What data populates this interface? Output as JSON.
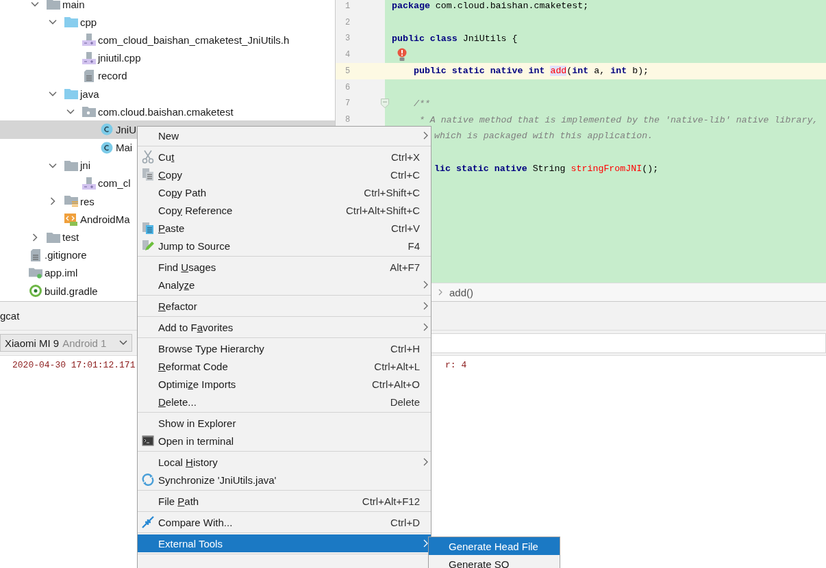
{
  "project_tree": {
    "nested_items": [
      {
        "label": "main",
        "kind": "folder",
        "expanded": true,
        "selected": false,
        "children": [
          {
            "label": "cpp",
            "kind": "source-folder",
            "expanded": true,
            "selected": false,
            "children": [
              {
                "label": "com_cloud_baishan_cmaketest_JniUtils.h",
                "kind": "cpp-file",
                "selected": false
              },
              {
                "label": "jniutil.cpp",
                "kind": "cpp-file",
                "selected": false
              },
              {
                "label": "record",
                "kind": "text-file",
                "selected": false
              }
            ]
          },
          {
            "label": "java",
            "kind": "source-folder",
            "expanded": true,
            "selected": false,
            "children": [
              {
                "label": "com.cloud.baishan.cmaketest",
                "kind": "package",
                "expanded": true,
                "selected": false,
                "children": [
                  {
                    "label": "JniU",
                    "kind": "class",
                    "selected": true
                  },
                  {
                    "label": "Mai",
                    "kind": "class",
                    "selected": false
                  }
                ]
              }
            ]
          },
          {
            "label": "jni",
            "kind": "folder",
            "expanded": true,
            "selected": false,
            "children": [
              {
                "label": "com_cl",
                "kind": "cpp-file",
                "selected": false
              }
            ]
          },
          {
            "label": "res",
            "kind": "res-folder",
            "expanded": false,
            "selected": false
          },
          {
            "label": "AndroidMa",
            "kind": "manifest",
            "selected": false
          }
        ]
      },
      {
        "label": "test",
        "kind": "folder",
        "expanded": false,
        "selected": false
      }
    ],
    "items": [
      {
        "label": ".gitignore",
        "kind": "text-file",
        "selected": false
      },
      {
        "label": "app.iml",
        "kind": "module-file",
        "selected": false
      },
      {
        "label": "build.gradle",
        "kind": "gradle",
        "selected": false
      }
    ]
  },
  "editor": {
    "lines": [
      {
        "number": "1",
        "kind": "code",
        "current": false,
        "tokens": [
          {
            "kind": "keyword",
            "text": "package"
          },
          {
            "kind": "text",
            "text": " com.cloud.baishan.cmaketest;"
          }
        ]
      },
      {
        "number": "2",
        "kind": "code",
        "current": false
      },
      {
        "number": "3",
        "kind": "code",
        "current": false,
        "tokens": [
          {
            "kind": "keyword",
            "text": "public class"
          },
          {
            "kind": "text",
            "text": " JniUtils {"
          }
        ]
      },
      {
        "number": "4",
        "kind": "bulb",
        "current": false
      },
      {
        "number": "5",
        "kind": "code",
        "current": true,
        "tokens": [
          {
            "kind": "keyword",
            "text": "    public static native int "
          },
          {
            "kind": "unresolved-focus",
            "text": "add"
          },
          {
            "kind": "text",
            "text": "("
          },
          {
            "kind": "keyword",
            "text": "int"
          },
          {
            "kind": "text",
            "text": " a, "
          },
          {
            "kind": "keyword",
            "text": "int"
          },
          {
            "kind": "text",
            "text": " b);"
          }
        ]
      },
      {
        "number": "6",
        "kind": "code",
        "current": false
      },
      {
        "number": "7",
        "kind": "fold",
        "current": false,
        "tokens": [
          {
            "kind": "comment",
            "text": "    /**"
          }
        ]
      },
      {
        "number": "8",
        "kind": "code",
        "current": false,
        "tokens": [
          {
            "kind": "comment",
            "text": "     * A native method that is implemented by the 'native-lib' native library,"
          }
        ]
      },
      {
        "kind": "clipped",
        "current": false,
        "tokens": [
          {
            "kind": "comment",
            "text": "which is packaged with this application."
          }
        ]
      },
      {
        "kind": "clipped",
        "current": false
      },
      {
        "kind": "clipped",
        "current": false,
        "tokens": [
          {
            "kind": "keyword",
            "text": "lic static native"
          },
          {
            "kind": "text",
            "text": " String "
          },
          {
            "kind": "unresolved",
            "text": "stringFromJNI"
          },
          {
            "kind": "text",
            "text": "();"
          }
        ]
      }
    ],
    "breadcrumb": "add()"
  },
  "log_panel": {
    "tab": "gcat",
    "device": {
      "name": "Xiaomi MI 9",
      "detail": "Android 1"
    },
    "log_lines": [
      {
        "start": "2020-04-30 17:01:12.171",
        "end": "r: 4"
      }
    ]
  },
  "context_menu": {
    "groups": [
      [
        {
          "label": "New",
          "submenu": true,
          "selected": false
        }
      ],
      [
        {
          "pre": "Cu",
          "key": "t",
          "shortcut": "Ctrl+X",
          "kind": "scissors",
          "selected": false
        },
        {
          "key": "C",
          "post": "opy",
          "shortcut": "Ctrl+C",
          "kind": "copy",
          "selected": false
        },
        {
          "pre": "Co",
          "key": "p",
          "post": "y Path",
          "shortcut": "Ctrl+Shift+C",
          "selected": false
        },
        {
          "pre": "Cop",
          "key": "y",
          "post": " Reference",
          "shortcut": "Ctrl+Alt+Shift+C",
          "selected": false
        },
        {
          "key": "P",
          "post": "aste",
          "shortcut": "Ctrl+V",
          "kind": "paste",
          "selected": false
        },
        {
          "label": "Jump to Source",
          "shortcut": "F4",
          "kind": "jump",
          "selected": false
        }
      ],
      [
        {
          "pre": "Find ",
          "key": "U",
          "post": "sages",
          "shortcut": "Alt+F7",
          "selected": false
        },
        {
          "pre": "Analy",
          "key": "z",
          "post": "e",
          "submenu": true,
          "selected": false
        }
      ],
      [
        {
          "key": "R",
          "post": "efactor",
          "submenu": true,
          "selected": false
        }
      ],
      [
        {
          "pre": "Add to F",
          "key": "a",
          "post": "vorites",
          "submenu": true,
          "selected": false
        }
      ],
      [
        {
          "label": "Browse Type Hierarchy",
          "shortcut": "Ctrl+H",
          "selected": false
        },
        {
          "key": "R",
          "post": "eformat Code",
          "shortcut": "Ctrl+Alt+L",
          "selected": false
        },
        {
          "pre": "Optimi",
          "key": "z",
          "post": "e Imports",
          "shortcut": "Ctrl+Alt+O",
          "selected": false
        },
        {
          "key": "D",
          "post": "elete...",
          "shortcut": "Delete",
          "selected": false
        }
      ],
      [
        {
          "label": "Show in Explorer",
          "selected": false
        },
        {
          "label": "Open in terminal",
          "kind": "terminal",
          "selected": false
        }
      ],
      [
        {
          "pre": "Local ",
          "key": "H",
          "post": "istory",
          "submenu": true,
          "selected": false
        },
        {
          "label": "Synchronize 'JniUtils.java'",
          "kind": "sync",
          "selected": false
        }
      ],
      [
        {
          "pre": "File ",
          "key": "P",
          "post": "ath",
          "shortcut": "Ctrl+Alt+F12",
          "selected": false
        }
      ],
      [
        {
          "label": "Compare With...",
          "shortcut": "Ctrl+D",
          "kind": "compare",
          "selected": false
        }
      ],
      [
        {
          "label": "External Tools",
          "submenu": true,
          "selected": true
        }
      ]
    ]
  },
  "submenu_popup": {
    "items": [
      {
        "label": "Generate Head File",
        "selected": true
      },
      {
        "label": "Generate SO",
        "selected": false
      }
    ]
  }
}
